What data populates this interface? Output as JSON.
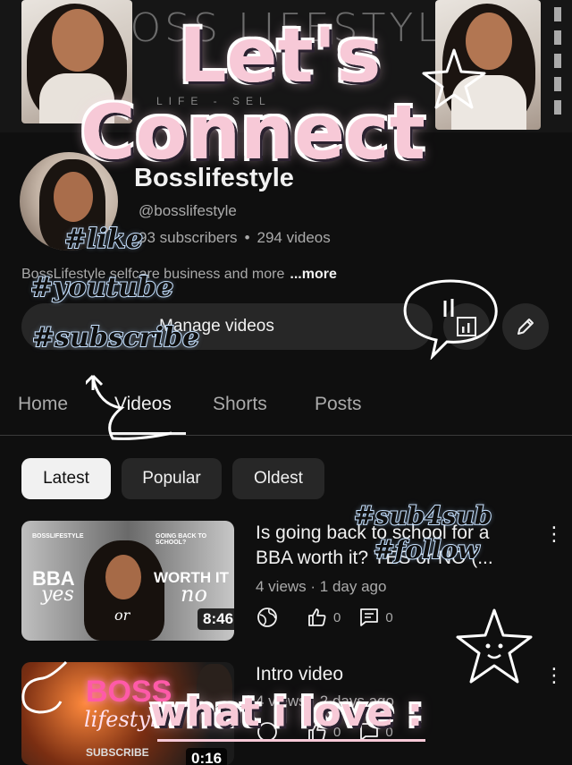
{
  "banner": {
    "wordmark": "BOSS LIFESTYLE",
    "tagline": "LIFE - SEL"
  },
  "overlay": {
    "headline_line1": "Let's",
    "headline_line2": "Connect",
    "tags": [
      "#like",
      "#youtube",
      "#subscribe",
      "#sub4sub",
      "#follow"
    ],
    "footer": "what i love :"
  },
  "channel": {
    "name": "Bosslifestyle",
    "handle": "@bosslifestyle",
    "subscribers": "93 subscribers",
    "videos": "294 videos",
    "description": "BossLifestyle selfcare business and more",
    "more_label": "...more"
  },
  "actions": {
    "manage_label": "Manage videos",
    "analytics_icon": "analytics-icon",
    "edit_icon": "pencil-icon"
  },
  "tabs": [
    {
      "label": "Home"
    },
    {
      "label": "Videos"
    },
    {
      "label": "Shorts"
    },
    {
      "label": "Posts"
    }
  ],
  "active_tab": "Videos",
  "chips": [
    {
      "label": "Latest"
    },
    {
      "label": "Popular"
    },
    {
      "label": "Oldest"
    }
  ],
  "videos": [
    {
      "thumb_top_left": "BOSSLIFESTYLE",
      "thumb_top_right": "GOING BACK TO SCHOOL?",
      "thumb_left_big": "BBA",
      "thumb_left_script": "yes",
      "thumb_right_big": "WORTH IT",
      "thumb_right_script": "no",
      "thumb_mid": "or",
      "duration": "8:46",
      "title": "Is going back to school for a BBA worth it? YES or NO (...",
      "meta": "4 views · 1 day ago",
      "likes": "0",
      "comments": "0"
    },
    {
      "thumb_neon": "BOSS",
      "thumb_script": "lifestyle",
      "thumb_footer": "SUBSCRIBE",
      "duration": "0:16",
      "title": "Intro video",
      "meta": "4 views · 2 days ago",
      "likes": "0",
      "comments": "0"
    }
  ],
  "colors": {
    "background": "#0f0f0f",
    "surface": "#272727",
    "text_primary": "#f1f1f1",
    "text_secondary": "#aaaaaa",
    "sticker_pink": "#f7c9d7"
  }
}
